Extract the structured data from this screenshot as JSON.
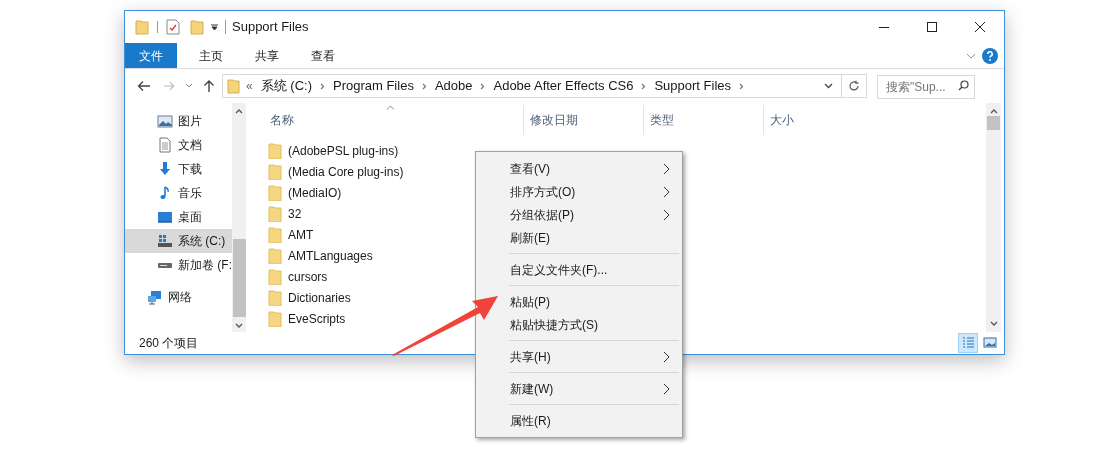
{
  "window": {
    "title": "Support Files"
  },
  "ribbon_tabs": [
    {
      "label": "文件",
      "selected": true
    },
    {
      "label": "主页",
      "selected": false
    },
    {
      "label": "共享",
      "selected": false
    },
    {
      "label": "查看",
      "selected": false
    }
  ],
  "address": {
    "overflow": "«",
    "segments": [
      "系统 (C:)",
      "Program Files",
      "Adobe",
      "Adobe After Effects CS6",
      "Support Files"
    ]
  },
  "search": {
    "placeholder": "搜索\"Sup..."
  },
  "sidebar": {
    "items": [
      {
        "label": "图片",
        "kind": "pictures",
        "selected": false
      },
      {
        "label": "文档",
        "kind": "documents",
        "selected": false
      },
      {
        "label": "下载",
        "kind": "downloads",
        "selected": false
      },
      {
        "label": "音乐",
        "kind": "music",
        "selected": false
      },
      {
        "label": "桌面",
        "kind": "desktop",
        "selected": false
      },
      {
        "label": "系统 (C:)",
        "kind": "system",
        "selected": true
      },
      {
        "label": "新加卷 (F:",
        "kind": "drive",
        "selected": false
      },
      {
        "label": "网络",
        "kind": "network",
        "selected": false
      }
    ]
  },
  "table": {
    "columns": [
      "名称",
      "修改日期",
      "类型",
      "大小"
    ],
    "rows": [
      {
        "name": "(AdobePSL plug-ins)"
      },
      {
        "name": "(Media Core plug-ins)"
      },
      {
        "name": "(MediaIO)"
      },
      {
        "name": "32"
      },
      {
        "name": "AMT"
      },
      {
        "name": "AMTLanguages"
      },
      {
        "name": "cursors"
      },
      {
        "name": "Dictionaries"
      },
      {
        "name": "EveScripts"
      }
    ]
  },
  "status_bar": {
    "count": "260 个项目",
    "views": [
      {
        "kind": "details",
        "selected": true
      },
      {
        "kind": "thumbnails",
        "selected": false
      }
    ]
  },
  "context_menu": {
    "groups": [
      [
        {
          "label": "查看(V)",
          "submenu": true
        },
        {
          "label": "排序方式(O)",
          "submenu": true
        },
        {
          "label": "分组依据(P)",
          "submenu": true
        },
        {
          "label": "刷新(E)",
          "submenu": false
        }
      ],
      [
        {
          "label": "自定义文件夹(F)...",
          "submenu": false
        }
      ],
      [
        {
          "label": "粘贴(P)",
          "submenu": false
        },
        {
          "label": "粘贴快捷方式(S)",
          "submenu": false
        }
      ],
      [
        {
          "label": "共享(H)",
          "submenu": true
        }
      ],
      [
        {
          "label": "新建(W)",
          "submenu": true
        }
      ],
      [
        {
          "label": "属性(R)",
          "submenu": false
        }
      ]
    ]
  }
}
